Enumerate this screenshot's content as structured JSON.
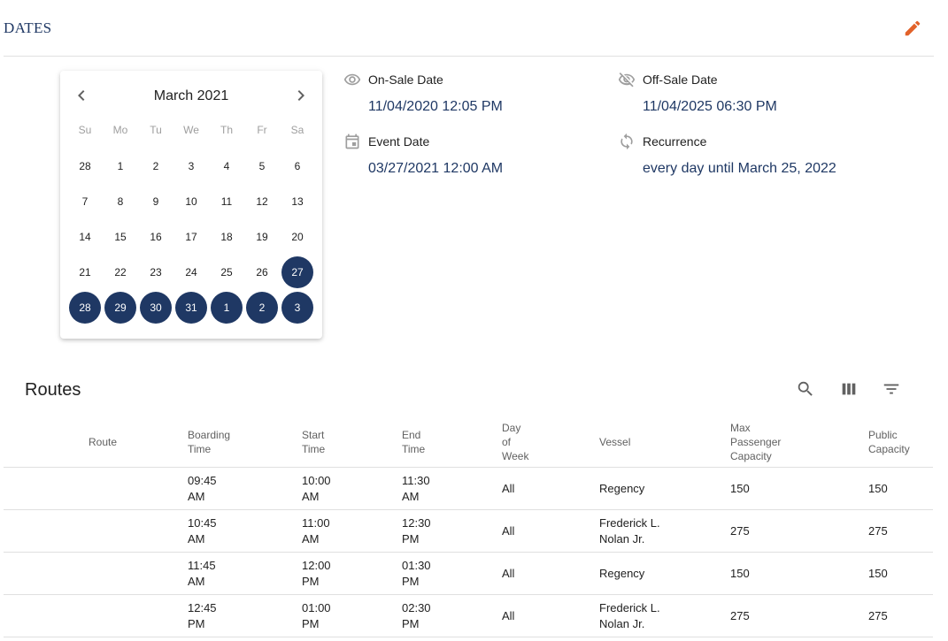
{
  "section": {
    "title": "DATES"
  },
  "calendar": {
    "month_label": "March 2021",
    "weekdays": [
      "Su",
      "Mo",
      "Tu",
      "We",
      "Th",
      "Fr",
      "Sa"
    ],
    "days": [
      {
        "d": "28",
        "sel": false
      },
      {
        "d": "1",
        "sel": false
      },
      {
        "d": "2",
        "sel": false
      },
      {
        "d": "3",
        "sel": false
      },
      {
        "d": "4",
        "sel": false
      },
      {
        "d": "5",
        "sel": false
      },
      {
        "d": "6",
        "sel": false
      },
      {
        "d": "7",
        "sel": false
      },
      {
        "d": "8",
        "sel": false
      },
      {
        "d": "9",
        "sel": false
      },
      {
        "d": "10",
        "sel": false
      },
      {
        "d": "11",
        "sel": false
      },
      {
        "d": "12",
        "sel": false
      },
      {
        "d": "13",
        "sel": false
      },
      {
        "d": "14",
        "sel": false
      },
      {
        "d": "15",
        "sel": false
      },
      {
        "d": "16",
        "sel": false
      },
      {
        "d": "17",
        "sel": false
      },
      {
        "d": "18",
        "sel": false
      },
      {
        "d": "19",
        "sel": false
      },
      {
        "d": "20",
        "sel": false
      },
      {
        "d": "21",
        "sel": false
      },
      {
        "d": "22",
        "sel": false
      },
      {
        "d": "23",
        "sel": false
      },
      {
        "d": "24",
        "sel": false
      },
      {
        "d": "25",
        "sel": false
      },
      {
        "d": "26",
        "sel": false
      },
      {
        "d": "27",
        "sel": true
      },
      {
        "d": "28",
        "sel": true
      },
      {
        "d": "29",
        "sel": true
      },
      {
        "d": "30",
        "sel": true
      },
      {
        "d": "31",
        "sel": true
      },
      {
        "d": "1",
        "sel": true
      },
      {
        "d": "2",
        "sel": true
      },
      {
        "d": "3",
        "sel": true
      }
    ]
  },
  "info": {
    "on_sale": {
      "label": "On-Sale Date",
      "value": "11/04/2020 12:05 PM",
      "icon": "eye-icon"
    },
    "off_sale": {
      "label": "Off-Sale Date",
      "value": "11/04/2025 06:30 PM",
      "icon": "eye-off-icon"
    },
    "event": {
      "label": "Event Date",
      "value": "03/27/2021 12:00 AM",
      "icon": "calendar-icon"
    },
    "recurrence": {
      "label": "Recurrence",
      "value": "every day until March 25, 2022",
      "icon": "refresh-icon"
    }
  },
  "routes": {
    "title": "Routes",
    "tools": [
      "search-icon",
      "columns-icon",
      "filter-icon"
    ],
    "headers": {
      "route": "Route",
      "boarding": [
        "Boarding",
        "Time"
      ],
      "start": [
        "Start",
        "Time"
      ],
      "end": [
        "End",
        "Time"
      ],
      "day": [
        "Day",
        "of",
        "Week"
      ],
      "vessel": "Vessel",
      "max_cap": [
        "Max",
        "Passenger",
        "Capacity"
      ],
      "public_cap": [
        "Public",
        "Capacity"
      ]
    },
    "rows": [
      {
        "route": "",
        "boarding": [
          "09:45",
          "AM"
        ],
        "start": [
          "10:00",
          "AM"
        ],
        "end": [
          "11:30",
          "AM"
        ],
        "day": "All",
        "vessel": [
          "Regency"
        ],
        "max": "150",
        "public": "150"
      },
      {
        "route": "",
        "boarding": [
          "10:45",
          "AM"
        ],
        "start": [
          "11:00",
          "AM"
        ],
        "end": [
          "12:30",
          "PM"
        ],
        "day": "All",
        "vessel": [
          "Frederick L.",
          "Nolan Jr."
        ],
        "max": "275",
        "public": "275"
      },
      {
        "route": "",
        "boarding": [
          "11:45",
          "AM"
        ],
        "start": [
          "12:00",
          "PM"
        ],
        "end": [
          "01:30",
          "PM"
        ],
        "day": "All",
        "vessel": [
          "Regency"
        ],
        "max": "150",
        "public": "150"
      },
      {
        "route": "",
        "boarding": [
          "12:45",
          "PM"
        ],
        "start": [
          "01:00",
          "PM"
        ],
        "end": [
          "02:30",
          "PM"
        ],
        "day": "All",
        "vessel": [
          "Frederick L.",
          "Nolan Jr."
        ],
        "max": "275",
        "public": "275"
      }
    ]
  },
  "colors": {
    "accent": "#1f3864",
    "edit": "#e2622a",
    "divider": "#e0e0e0"
  }
}
